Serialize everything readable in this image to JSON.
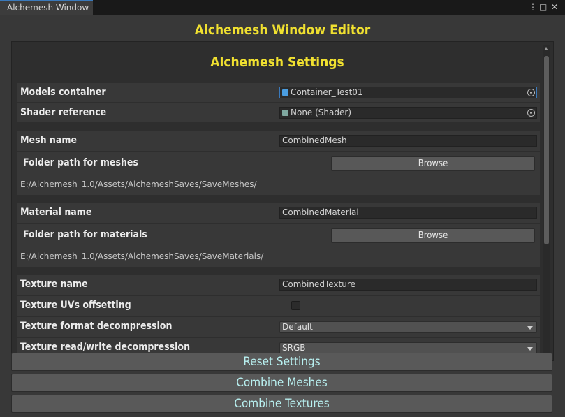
{
  "window": {
    "tab_title": "Alchemesh Window",
    "title": "Alchemesh Window Editor",
    "menu_glyph": "⋮",
    "maximize_glyph": "□",
    "close_glyph": "✕"
  },
  "settings": {
    "section_title": "Alchemesh Settings",
    "models_container": {
      "label": "Models container",
      "value": "Container_Test01",
      "icon": "prefab-icon"
    },
    "shader_reference": {
      "label": "Shader reference",
      "value": "None (Shader)",
      "icon": "shader-icon"
    },
    "mesh_name": {
      "label": "Mesh name",
      "value": "CombinedMesh"
    },
    "mesh_folder": {
      "label": "Folder path for meshes",
      "button": "Browse",
      "path": "E:/Alchemesh_1.0/Assets/AlchemeshSaves/SaveMeshes/"
    },
    "material_name": {
      "label": "Material name",
      "value": "CombinedMaterial"
    },
    "material_folder": {
      "label": "Folder path for materials",
      "button": "Browse",
      "path": "E:/Alchemesh_1.0/Assets/AlchemeshSaves/SaveMaterials/"
    },
    "texture_name": {
      "label": "Texture name",
      "value": "CombinedTexture"
    },
    "texture_uvs_offsetting": {
      "label": "Texture UVs offsetting",
      "checked": false
    },
    "texture_format_decompression": {
      "label": "Texture format decompression",
      "value": "Default"
    },
    "texture_partial_row": {
      "label": "Texture read/write decompression",
      "value": "SRGB"
    }
  },
  "actions": {
    "reset": "Reset Settings",
    "combine_meshes": "Combine Meshes",
    "combine_textures": "Combine Textures"
  },
  "colors": {
    "accent_title": "#f0e030",
    "button_text": "#b8f0f0",
    "focus_border": "#3a79bb"
  }
}
